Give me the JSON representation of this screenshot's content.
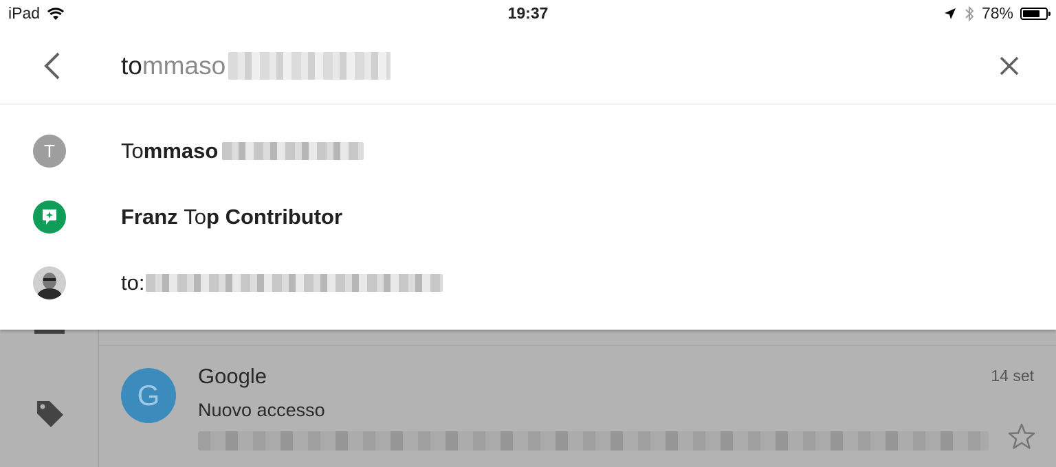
{
  "status_bar": {
    "device": "iPad",
    "time": "19:37",
    "battery_percent": "78%",
    "battery_level": 0.78
  },
  "search": {
    "typed_text": "to",
    "completion_text": "mmaso"
  },
  "suggestions": [
    {
      "icon": "contact-initial-avatar",
      "avatar_letter": "T",
      "avatar_color": "#9e9e9e",
      "parts": [
        {
          "text": "To",
          "bold": false
        },
        {
          "text": "mmaso",
          "bold": true
        }
      ]
    },
    {
      "icon": "hangouts-icon",
      "avatar_color": "#0f9d58",
      "parts": [
        {
          "text": "Franz ",
          "bold": true
        },
        {
          "text": "To",
          "bold": false
        },
        {
          "text": "p Contributor",
          "bold": true
        }
      ]
    },
    {
      "icon": "contact-photo-avatar",
      "parts": [
        {
          "text": "to:",
          "bold": false
        }
      ]
    }
  ],
  "inbox": {
    "message": {
      "avatar_letter": "G",
      "avatar_color": "#3b8bbd",
      "sender": "Google",
      "subject": "Nuovo accesso",
      "date": "14 set"
    }
  }
}
